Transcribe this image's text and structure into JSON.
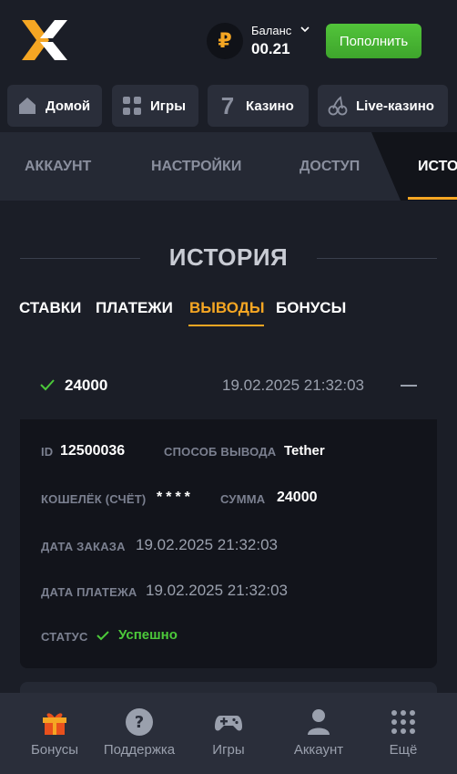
{
  "header": {
    "balance_symbol": "₽",
    "balance_label": "Баланс",
    "balance_value": "00.21",
    "topup_label": "Пополнить"
  },
  "topnav": [
    {
      "label": "Домой",
      "icon": "home-icon"
    },
    {
      "label": "Игры",
      "icon": "grid-icon"
    },
    {
      "label": "Казино",
      "icon": "seven-icon"
    },
    {
      "label": "Live-казино",
      "icon": "cherry-icon"
    }
  ],
  "tabs": [
    "АККАУНТ",
    "НАСТРОЙКИ",
    "ДОСТУП",
    "ИСТОРИЯ"
  ],
  "section_title": "ИСТОРИЯ",
  "subtabs": [
    "СТАВКИ",
    "ПЛАТЕЖИ",
    "ВЫВОДЫ",
    "БОНУСЫ"
  ],
  "record": {
    "amount": "24000",
    "date": "19.02.2025 21:32:03",
    "details": {
      "id_label": "ID",
      "id_value": "12500036",
      "method_label": "СПОСОБ ВЫВОДА",
      "method_value": "Tether",
      "wallet_label": "КОШЕЛЁК (СЧЁТ)",
      "wallet_value": "****",
      "sum_label": "СУММА",
      "sum_value": "24000",
      "order_date_label": "ДАТА ЗАКАЗА",
      "order_date_value": "19.02.2025 21:32:03",
      "payment_date_label": "ДАТА ПЛАТЕЖА",
      "payment_date_value": "19.02.2025 21:32:03",
      "status_label": "СТАТУС",
      "status_value": "Успешно"
    }
  },
  "bottomnav": [
    {
      "label": "Бонусы",
      "icon": "gift-icon"
    },
    {
      "label": "Поддержка",
      "icon": "question-icon"
    },
    {
      "label": "Игры",
      "icon": "gamepad-icon"
    },
    {
      "label": "Аккаунт",
      "icon": "user-icon"
    },
    {
      "label": "Ещё",
      "icon": "dots-grid-icon"
    }
  ],
  "colors": {
    "accent": "#f5a623",
    "success": "#4cc93a",
    "background": "#1b1e27"
  }
}
